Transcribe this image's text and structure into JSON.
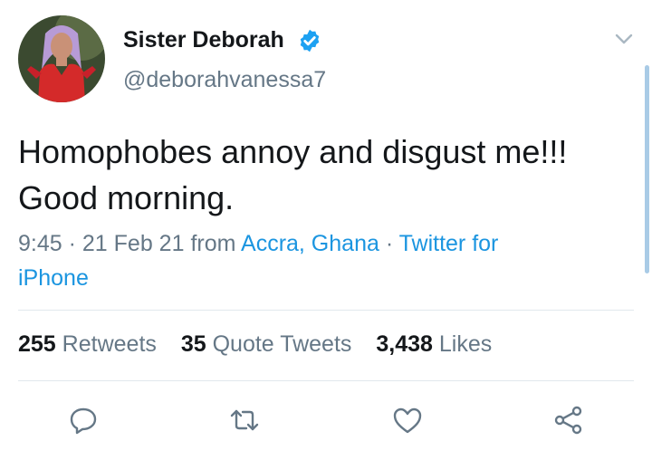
{
  "author": {
    "display_name": "Sister Deborah",
    "handle": "@deborahvanessa7",
    "verified": true
  },
  "tweet": {
    "text_line1": "Homophobes annoy and disgust me!!!",
    "text_line2": "Good morning."
  },
  "meta": {
    "time": "9:45",
    "date": "21 Feb 21",
    "from_label": "from",
    "location": "Accra, Ghana",
    "client_line1": "Twitter for",
    "client_line2": "iPhone",
    "separator": " · "
  },
  "stats": {
    "retweets_count": "255",
    "retweets_label": "Retweets",
    "quotes_count": "35",
    "quotes_label": "Quote Tweets",
    "likes_count": "3,438",
    "likes_label": "Likes"
  },
  "icons": {
    "reply": "reply-icon",
    "retweet": "retweet-icon",
    "like": "heart-icon",
    "share": "share-icon",
    "verified": "verified-badge-icon",
    "more": "chevron-down-icon"
  },
  "colors": {
    "link": "#1b95e0",
    "secondary_text": "#657786",
    "primary_text": "#14171a",
    "verified": "#1da1f2"
  }
}
